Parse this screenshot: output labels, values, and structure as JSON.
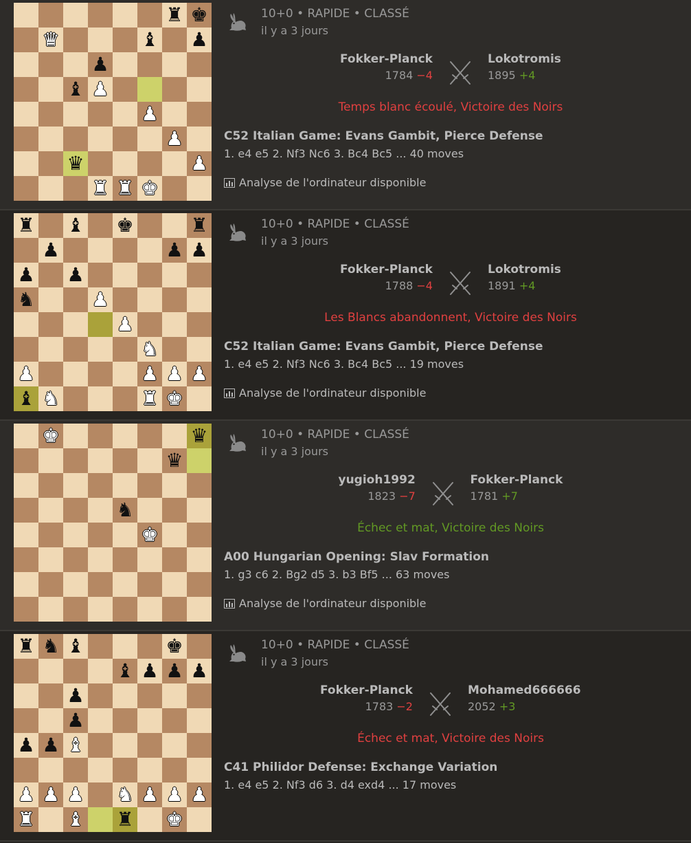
{
  "games": [
    {
      "speed": "10+0 • RAPIDE • CLASSÉ",
      "ago": "il y a 3 jours",
      "white": {
        "name": "Fokker-Planck",
        "rating": "1784",
        "diff": "−4",
        "diff_sign": "neg"
      },
      "black": {
        "name": "Lokotromis",
        "rating": "1895",
        "diff": "+4",
        "diff_sign": "pos"
      },
      "result": "Temps blanc écoulé, Victoire des Noirs",
      "result_type": "loss",
      "opening": "C52 Italian Game: Evans Gambit, Pierce Defense",
      "moves": "1. e4 e5 2. Nf3 Nc6 3. Bc4 Bc5 ... 40 moves",
      "analysis": "Analyse de l'ordinateur disponible",
      "board": [
        "......rk",
        ".Q...b.p",
        "...p....",
        "..bP....",
        ".....P..",
        "......P.",
        "..q....P",
        "...RRK.."
      ],
      "highlights": [
        "f5",
        "c2"
      ]
    },
    {
      "speed": "10+0 • RAPIDE • CLASSÉ",
      "ago": "il y a 3 jours",
      "white": {
        "name": "Fokker-Planck",
        "rating": "1788",
        "diff": "−4",
        "diff_sign": "neg"
      },
      "black": {
        "name": "Lokotromis",
        "rating": "1891",
        "diff": "+4",
        "diff_sign": "pos"
      },
      "result": "Les Blancs abandonnent, Victoire des Noirs",
      "result_type": "loss",
      "opening": "C52 Italian Game: Evans Gambit, Pierce Defense",
      "moves": "1. e4 e5 2. Nf3 Nc6 3. Bc4 Bc5 ... 19 moves",
      "analysis": "Analyse de l'ordinateur disponible",
      "board": [
        "r.b.k..r",
        ".p....pp",
        "p.p.....",
        "n..P....",
        "....P...",
        ".....N..",
        "P....PPP",
        "bN...RK."
      ],
      "highlights": [
        "d4",
        "a1"
      ]
    },
    {
      "speed": "10+0 • RAPIDE • CLASSÉ",
      "ago": "il y a 3 jours",
      "white": {
        "name": "yugioh1992",
        "rating": "1823",
        "diff": "−7",
        "diff_sign": "neg"
      },
      "black": {
        "name": "Fokker-Planck",
        "rating": "1781",
        "diff": "+7",
        "diff_sign": "pos"
      },
      "result": "Échec et mat, Victoire des Noirs",
      "result_type": "win",
      "opening": "A00 Hungarian Opening: Slav Formation",
      "moves": "1. g3 c6 2. Bg2 d5 3. b3 Bf5 ... 63 moves",
      "analysis": "Analyse de l'ordinateur disponible",
      "board": [
        ".K.....q",
        "......q.",
        "........",
        "....n...",
        ".....K..",
        "........",
        "........",
        "........"
      ],
      "highlights": [
        "h8",
        "h7"
      ]
    },
    {
      "speed": "10+0 • RAPIDE • CLASSÉ",
      "ago": "il y a 3 jours",
      "white": {
        "name": "Fokker-Planck",
        "rating": "1783",
        "diff": "−2",
        "diff_sign": "neg"
      },
      "black": {
        "name": "Mohamed666666",
        "rating": "2052",
        "diff": "+3",
        "diff_sign": "pos"
      },
      "result": "Échec et mat, Victoire des Noirs",
      "result_type": "loss",
      "opening": "C41 Philidor Defense: Exchange Variation",
      "moves": "1. e4 e5 2. Nf3 d6 3. d4 exd4 ... 17 moves",
      "analysis": "",
      "board": [
        "rnb...k.",
        "....bppp",
        "..p.....",
        "..p.....",
        "ppB.....",
        "........",
        "PPP.NPPP",
        "R.B.r.K."
      ],
      "highlights": [
        "d1",
        "e1"
      ]
    }
  ],
  "colors": {
    "light_square": "#f0d9b5",
    "dark_square": "#b58863",
    "loss": "#e04040",
    "win": "#629924"
  },
  "icons": {
    "speed": "hare-icon",
    "versus": "crossed-swords-icon",
    "analysis": "bar-chart-icon"
  }
}
